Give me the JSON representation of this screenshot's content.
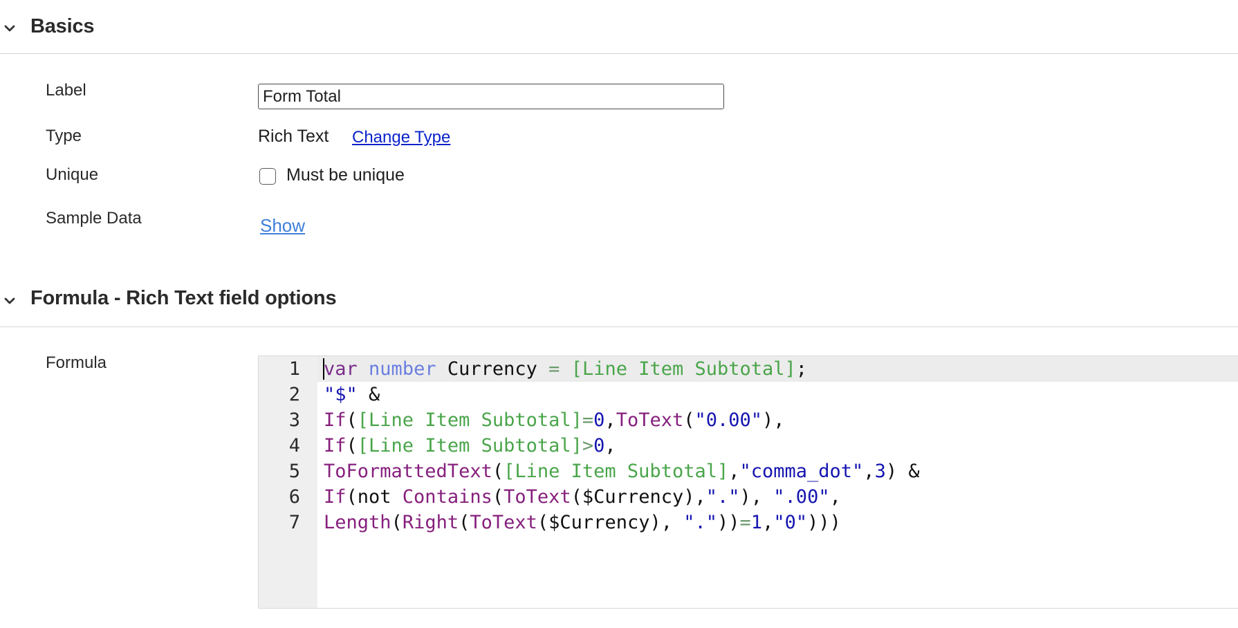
{
  "basics": {
    "title": "Basics",
    "fields": {
      "label": {
        "label": "Label",
        "value": "Form Total"
      },
      "type": {
        "label": "Type",
        "value": "Rich Text",
        "change_link": "Change Type"
      },
      "unique": {
        "label": "Unique",
        "checkbox_label": "Must be unique",
        "checked": false
      },
      "sample_data": {
        "label": "Sample Data",
        "link": "Show"
      }
    }
  },
  "formula_section": {
    "title": "Formula - Rich Text field options",
    "formula_label": "Formula",
    "line_numbers": [
      "1",
      "2",
      "3",
      "4",
      "5",
      "6",
      "7"
    ],
    "code_lines": [
      [
        {
          "t": "var",
          "k": "kw"
        },
        {
          "t": " ",
          "k": "plain"
        },
        {
          "t": "number",
          "k": "type"
        },
        {
          "t": " Currency ",
          "k": "plain"
        },
        {
          "t": "=",
          "k": "op"
        },
        {
          "t": " ",
          "k": "plain"
        },
        {
          "t": "[Line Item Subtotal]",
          "k": "field"
        },
        {
          "t": ";",
          "k": "plain"
        }
      ],
      [
        {
          "t": "\"$\"",
          "k": "str"
        },
        {
          "t": " &",
          "k": "plain"
        }
      ],
      [
        {
          "t": "If",
          "k": "fn"
        },
        {
          "t": "(",
          "k": "plain"
        },
        {
          "t": "[Line Item Subtotal]",
          "k": "field"
        },
        {
          "t": "=",
          "k": "op"
        },
        {
          "t": "0",
          "k": "num"
        },
        {
          "t": ",",
          "k": "plain"
        },
        {
          "t": "ToText",
          "k": "fn"
        },
        {
          "t": "(",
          "k": "plain"
        },
        {
          "t": "\"0.00\"",
          "k": "str"
        },
        {
          "t": "),",
          "k": "plain"
        }
      ],
      [
        {
          "t": "If",
          "k": "fn"
        },
        {
          "t": "(",
          "k": "plain"
        },
        {
          "t": "[Line Item Subtotal]",
          "k": "field"
        },
        {
          "t": ">",
          "k": "op"
        },
        {
          "t": "0",
          "k": "num"
        },
        {
          "t": ",",
          "k": "plain"
        }
      ],
      [
        {
          "t": "ToFormattedText",
          "k": "fn"
        },
        {
          "t": "(",
          "k": "plain"
        },
        {
          "t": "[Line Item Subtotal]",
          "k": "field"
        },
        {
          "t": ",",
          "k": "plain"
        },
        {
          "t": "\"comma_dot\"",
          "k": "str"
        },
        {
          "t": ",",
          "k": "plain"
        },
        {
          "t": "3",
          "k": "num"
        },
        {
          "t": ") &",
          "k": "plain"
        }
      ],
      [
        {
          "t": "If",
          "k": "fn"
        },
        {
          "t": "(not ",
          "k": "plain"
        },
        {
          "t": "Contains",
          "k": "fn"
        },
        {
          "t": "(",
          "k": "plain"
        },
        {
          "t": "ToText",
          "k": "fn"
        },
        {
          "t": "($Currency),",
          "k": "plain"
        },
        {
          "t": "\".\"",
          "k": "str"
        },
        {
          "t": "), ",
          "k": "plain"
        },
        {
          "t": "\".00\"",
          "k": "str"
        },
        {
          "t": ",",
          "k": "plain"
        }
      ],
      [
        {
          "t": "Length",
          "k": "fn"
        },
        {
          "t": "(",
          "k": "plain"
        },
        {
          "t": "Right",
          "k": "fn"
        },
        {
          "t": "(",
          "k": "plain"
        },
        {
          "t": "ToText",
          "k": "fn"
        },
        {
          "t": "($Currency), ",
          "k": "plain"
        },
        {
          "t": "\".\"",
          "k": "str"
        },
        {
          "t": "))",
          "k": "plain"
        },
        {
          "t": "=",
          "k": "op"
        },
        {
          "t": "1",
          "k": "num"
        },
        {
          "t": ",",
          "k": "plain"
        },
        {
          "t": "\"0\"",
          "k": "str"
        },
        {
          "t": ")))",
          "k": "plain"
        }
      ]
    ]
  },
  "colors": {
    "keyword": "#7a2d8a",
    "type": "#6a7ee0",
    "field_ref": "#4aa54a",
    "function": "#86207d",
    "literal": "#1515b0",
    "link": "#0b23c9",
    "link_light": "#3f7fd9"
  },
  "icons": {
    "section_toggle": "chevron-down-icon"
  }
}
